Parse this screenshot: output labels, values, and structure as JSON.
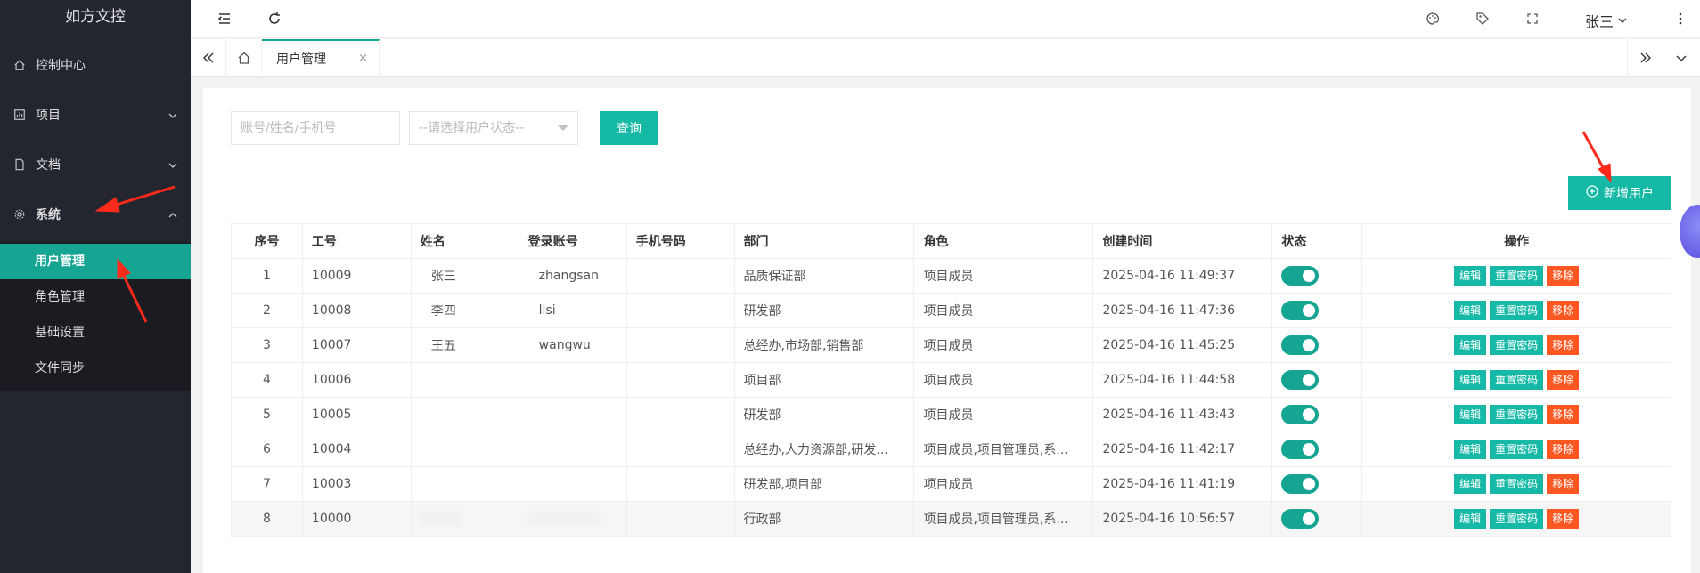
{
  "sidebar": {
    "brand": "如方文控",
    "menu": [
      {
        "label": "控制中心",
        "icon": "home-icon"
      },
      {
        "label": "项目",
        "icon": "project-icon"
      },
      {
        "label": "文档",
        "icon": "document-icon"
      },
      {
        "label": "系统",
        "icon": "gear-icon"
      }
    ],
    "submenu": [
      "用户管理",
      "角色管理",
      "基础设置",
      "文件同步"
    ]
  },
  "header": {
    "user": "张三"
  },
  "tabs": {
    "active": "用户管理",
    "close": "×"
  },
  "filters": {
    "search_placeholder": "账号/姓名/手机号",
    "status_placeholder": "--请选择用户状态--",
    "query_label": "查询",
    "add_label": "新增用户"
  },
  "table": {
    "headers": [
      "序号",
      "工号",
      "姓名",
      "登录账号",
      "手机号码",
      "部门",
      "角色",
      "创建时间",
      "状态",
      "操作"
    ],
    "actions": {
      "edit": "编辑",
      "reset": "重置密码",
      "remove": "移除"
    },
    "rows": [
      {
        "no": "1",
        "id": "10009",
        "name": "张三",
        "account": "zhangsan",
        "phone": "",
        "dept": "品质保证部",
        "role": "项目成员",
        "created": "2025-04-16 11:49:37"
      },
      {
        "no": "2",
        "id": "10008",
        "name": "李四",
        "account": "lisi",
        "phone": "",
        "dept": "研发部",
        "role": "项目成员",
        "created": "2025-04-16 11:47:36"
      },
      {
        "no": "3",
        "id": "10007",
        "name": "王五",
        "account": "wangwu",
        "phone": "",
        "dept": "总经办,市场部,销售部",
        "role": "项目成员",
        "created": "2025-04-16 11:45:25"
      },
      {
        "no": "4",
        "id": "10006",
        "name": "",
        "account": "",
        "phone": "",
        "dept": "项目部",
        "role": "项目成员",
        "created": "2025-04-16 11:44:58"
      },
      {
        "no": "5",
        "id": "10005",
        "name": "",
        "account": "",
        "phone": "",
        "dept": "研发部",
        "role": "项目成员",
        "created": "2025-04-16 11:43:43"
      },
      {
        "no": "6",
        "id": "10004",
        "name": "",
        "account": "",
        "phone": "",
        "dept": "总经办,人力资源部,研发...",
        "role": "项目成员,项目管理员,系...",
        "created": "2025-04-16 11:42:17"
      },
      {
        "no": "7",
        "id": "10003",
        "name": "",
        "account": "",
        "phone": "",
        "dept": "研发部,项目部",
        "role": "项目成员",
        "created": "2025-04-16 11:41:19"
      },
      {
        "no": "8",
        "id": "10000",
        "name": "",
        "account": "",
        "phone": "",
        "dept": "行政部",
        "role": "项目成员,项目管理员,系...",
        "created": "2025-04-16 10:56:57"
      }
    ]
  },
  "colors": {
    "primary": "#16a593",
    "button": "#16b9a6",
    "danger": "#ff5722",
    "sidebar": "#23262e",
    "arrow": "#ff2a1a"
  }
}
